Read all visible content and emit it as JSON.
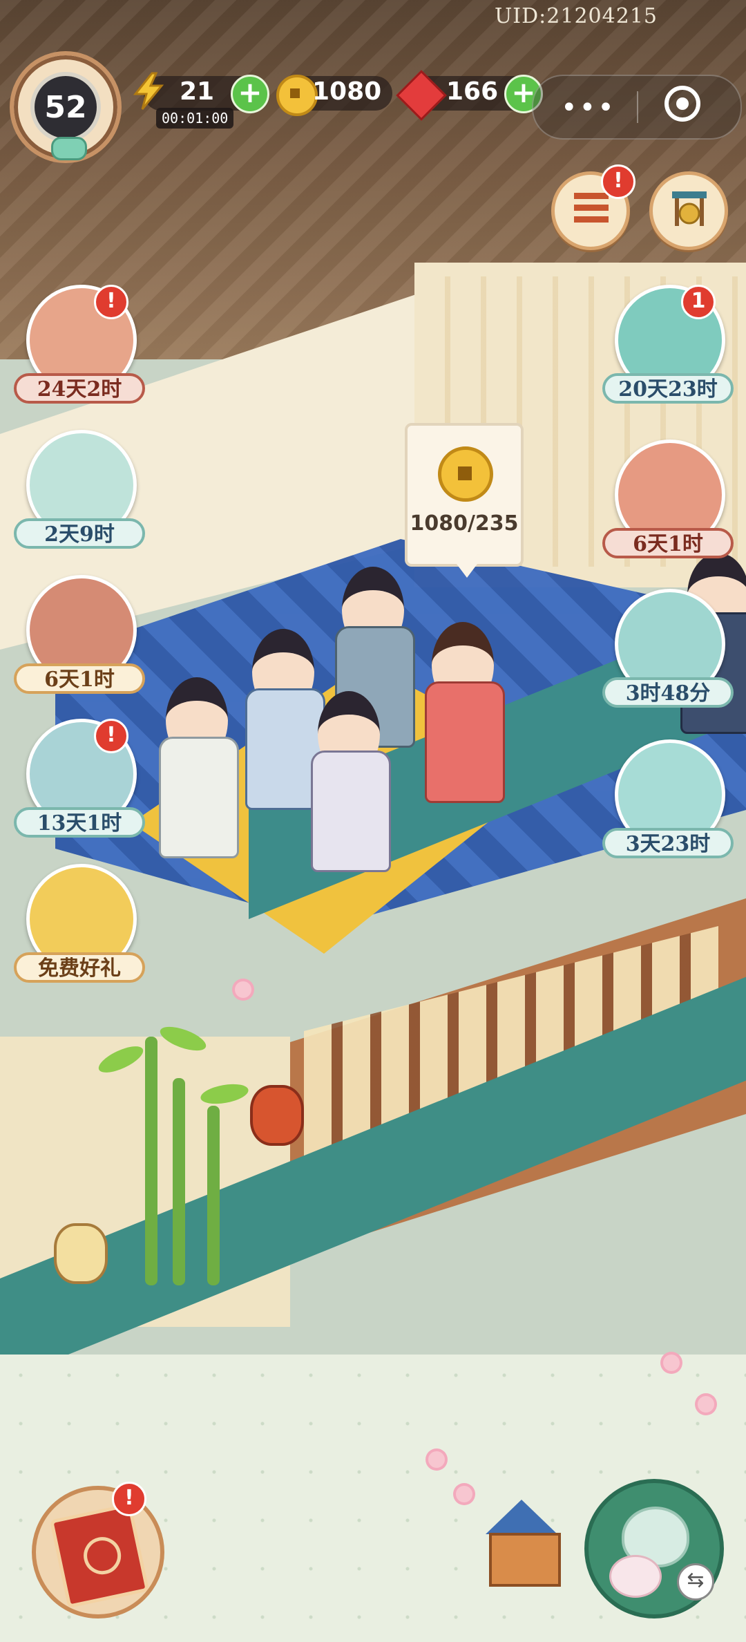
{
  "header": {
    "uid": "UID:21204215",
    "level": "52",
    "energy": {
      "value": "21",
      "timer": "00:01:00"
    },
    "coins": "1080",
    "gems": "166",
    "menu_more_symbol": "•••"
  },
  "side_events_left": [
    {
      "label": "24天2时",
      "icon": "calendar-book-icon",
      "alert": true
    },
    {
      "label": "2天9时",
      "icon": "lucky-cat-coin-icon",
      "alert": false
    },
    {
      "label": "6天1时",
      "icon": "tea-set-icon",
      "alert": false
    },
    {
      "label": "13天1时",
      "icon": "maple-bowl-icon",
      "alert": true
    },
    {
      "label": "免费好礼",
      "icon": "free-gift-icon",
      "alert": false
    }
  ],
  "side_events_right": [
    {
      "label": "20天23时",
      "icon": "dragon-onsen-icon",
      "badge": "1"
    },
    {
      "label": "6天1时",
      "icon": "fan-cat-icon"
    },
    {
      "label": "3时48分",
      "icon": "jade-chest-icon"
    },
    {
      "label": "3天23时",
      "icon": "cat-giftbox-icon"
    }
  ],
  "tooltip": {
    "icon": "coin-icon",
    "text": "1080/235"
  },
  "top_buttons": [
    {
      "icon": "task-list-icon",
      "alert": true
    },
    {
      "icon": "gong-icon",
      "alert": false
    }
  ],
  "bottom_buttons": [
    {
      "icon": "storybook-icon",
      "alert": true
    },
    {
      "icon": "shop-house-icon"
    },
    {
      "icon": "teapot-bunny-icon"
    }
  ],
  "alert_symbol": "!",
  "swap_symbol": "⇆",
  "colors": {
    "plus": "#5bc34a",
    "alert": "#e03c2f",
    "coin": "#f3c13a",
    "gem": "#e33c3c"
  }
}
